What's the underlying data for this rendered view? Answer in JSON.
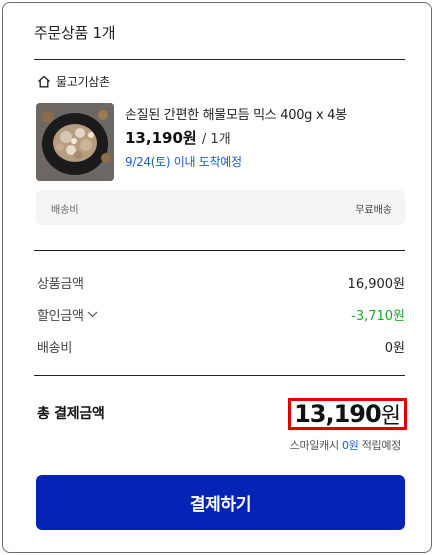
{
  "order": {
    "title": "주문상품 1개",
    "store": {
      "name": "물고기삼촌",
      "icon": "home-icon"
    },
    "product": {
      "name": "손질된 간편한 해물모듬 믹스 400g x 4봉",
      "price": "13,190원",
      "quantity": "/ 1개",
      "arrival": "9/24(토) 이내 도착예정"
    },
    "shipping": {
      "label": "배송비",
      "value": "무료배송"
    }
  },
  "summary": {
    "items": [
      {
        "label": "상품금액",
        "value": "16,900원"
      },
      {
        "label": "할인금액",
        "value": "-3,710원",
        "color": "#23a42a"
      },
      {
        "label": "배송비",
        "value": "0원"
      }
    ],
    "total": {
      "label": "총 결제금액",
      "amount": "13,190",
      "unit": "원"
    },
    "smilecash": {
      "prefix": "스마일캐시",
      "amount": "0원",
      "suffix": "적립예정"
    }
  },
  "pay_button": {
    "label": "결제하기",
    "color": "#0523b4"
  },
  "highlight_color": "#e00000"
}
